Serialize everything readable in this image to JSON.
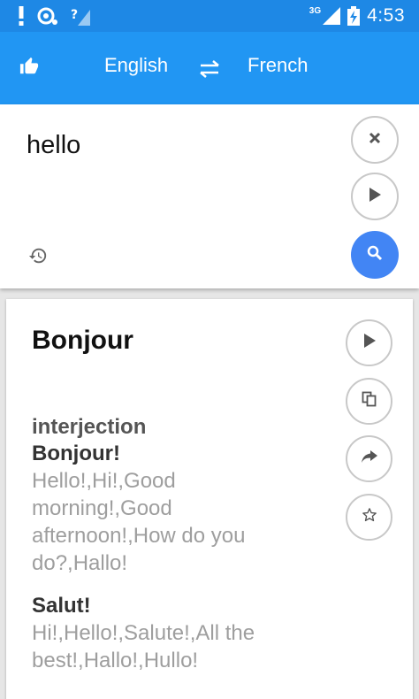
{
  "status_bar": {
    "network": "3G",
    "time": "4:53",
    "icons": [
      "alert-icon",
      "sync-icon",
      "wifi-unknown-icon",
      "signal-icon",
      "battery-charging-icon"
    ]
  },
  "toolbar": {
    "source_language": "English",
    "target_language": "French",
    "icons": [
      "thumbs-up-icon",
      "swap-icon"
    ]
  },
  "input": {
    "text": "hello",
    "icons": [
      "close-icon",
      "play-icon",
      "history-icon",
      "search-icon"
    ]
  },
  "result": {
    "translation": "Bonjour",
    "part_of_speech": "interjection",
    "entries": [
      {
        "word": "Bonjour!",
        "meaning": "Hello!,Hi!,Good morning!,Good afternoon!,How do you do?,Hallo!"
      },
      {
        "word": "Salut!",
        "meaning": "Hi!,Hello!,Salute!,All the best!,Hallo!,Hullo!"
      }
    ],
    "icons": [
      "play-icon",
      "copy-icon",
      "share-icon",
      "star-icon"
    ]
  },
  "colors": {
    "status_bar": "#1e88e5",
    "toolbar": "#2196f3",
    "search_button": "#4285f4",
    "meaning_text": "#9e9e9e"
  }
}
